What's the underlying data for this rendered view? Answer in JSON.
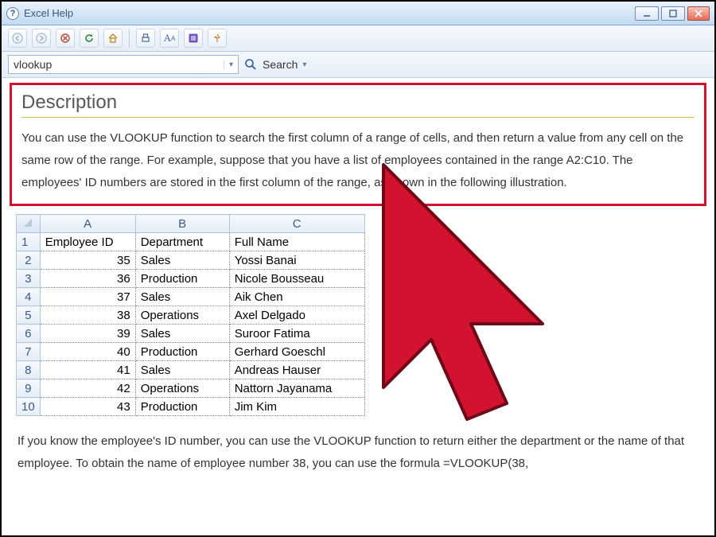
{
  "window": {
    "title": "Excel Help",
    "icon_letter": "?"
  },
  "toolbar": {
    "back": "←",
    "fwd": "→",
    "stop": "✕",
    "refresh": "⟳",
    "home": "⌂",
    "print": "🖶",
    "font": "A",
    "toc": "📖",
    "pin": "📌"
  },
  "search": {
    "value": "vlookup",
    "button_label": "Search",
    "dropdown": "▾"
  },
  "description": {
    "heading": "Description",
    "body": "You can use the VLOOKUP function to search the first column of a range of cells, and then return a value from any cell on the same row of the range. For example, suppose that you have a list of employees contained in the range A2:C10. The employees' ID numbers are stored in the first column of the range, as shown in the following illustration."
  },
  "table": {
    "col_headers": [
      "A",
      "B",
      "C"
    ],
    "field_headers": [
      "Employee ID",
      "Department",
      "Full Name"
    ],
    "rows": [
      {
        "n": 1
      },
      {
        "n": 2,
        "a": "35",
        "b": "Sales",
        "c": "Yossi Banai"
      },
      {
        "n": 3,
        "a": "36",
        "b": "Production",
        "c": "Nicole Bousseau"
      },
      {
        "n": 4,
        "a": "37",
        "b": "Sales",
        "c": "Aik Chen"
      },
      {
        "n": 5,
        "a": "38",
        "b": "Operations",
        "c": "Axel Delgado"
      },
      {
        "n": 6,
        "a": "39",
        "b": "Sales",
        "c": "Suroor Fatima"
      },
      {
        "n": 7,
        "a": "40",
        "b": "Production",
        "c": "Gerhard Goeschl"
      },
      {
        "n": 8,
        "a": "41",
        "b": "Sales",
        "c": "Andreas Hauser"
      },
      {
        "n": 9,
        "a": "42",
        "b": "Operations",
        "c": "Nattorn Jayanama"
      },
      {
        "n": 10,
        "a": "43",
        "b": "Production",
        "c": "Jim Kim"
      }
    ]
  },
  "followup": "If you know the employee's ID number, you can use the VLOOKUP function to return either the department or the name of that employee. To obtain the name of employee number 38, you can use the formula =VLOOKUP(38,",
  "cursor_color": "#d2122e"
}
